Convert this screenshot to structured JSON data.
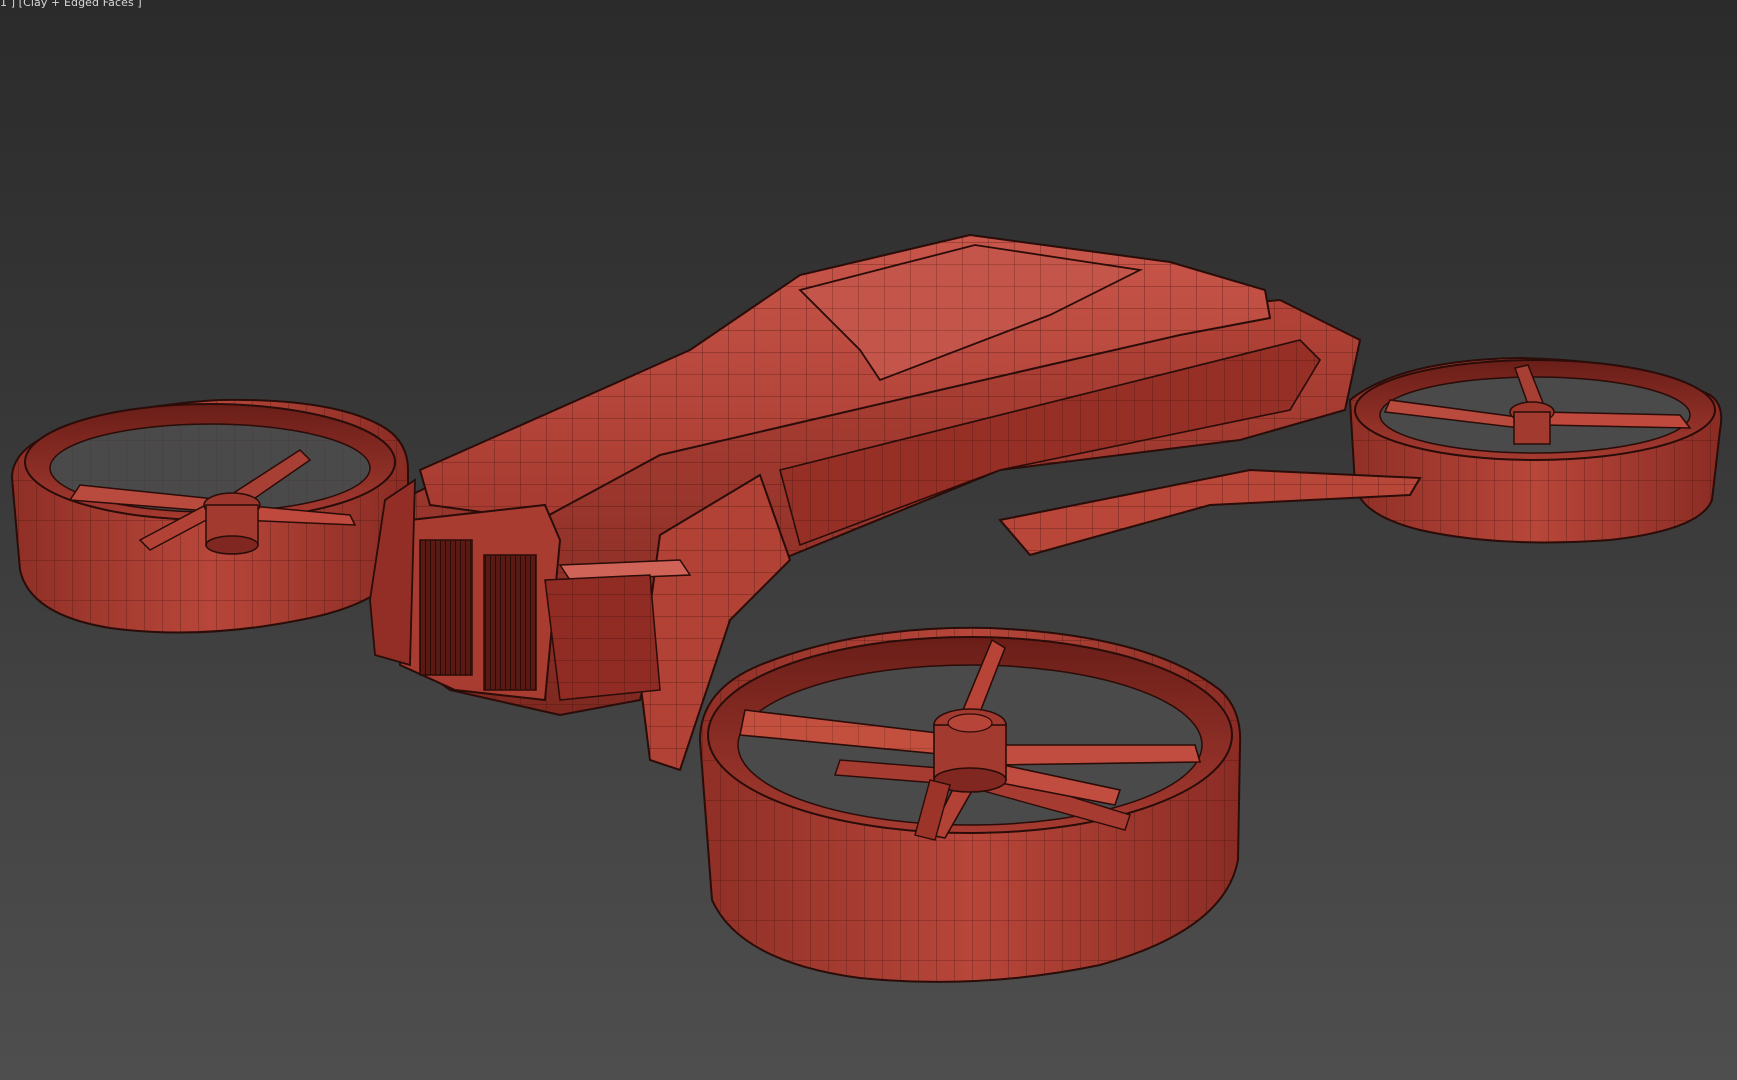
{
  "viewport": {
    "label": "1 ] [Clay + Edged Faces ]",
    "background_top": "#2b2b2b",
    "background_bottom": "#4e4e4e"
  },
  "model": {
    "name": "flying-car-drone",
    "material_color": "#c0473a",
    "wire_color": "#2a0c08"
  }
}
